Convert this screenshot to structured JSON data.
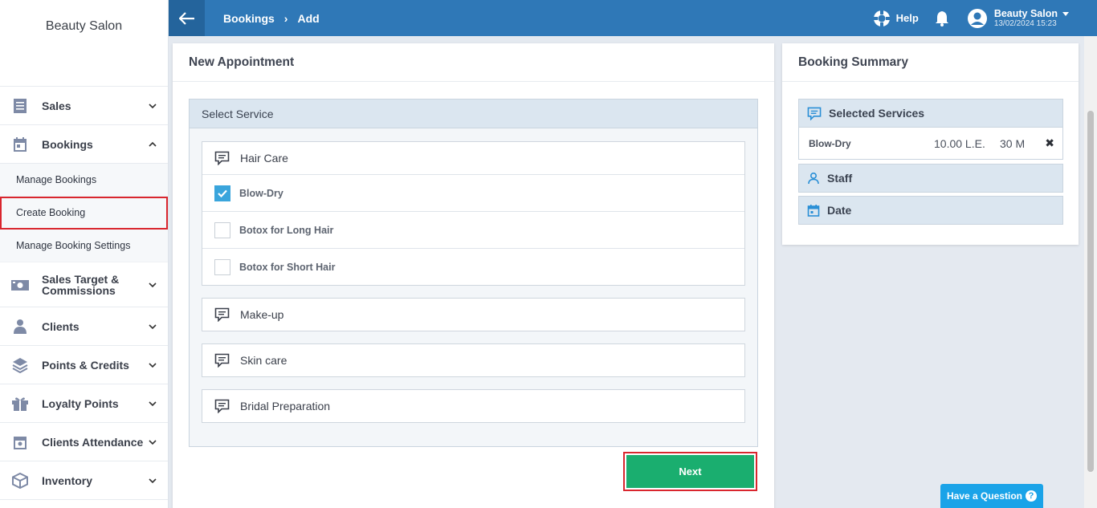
{
  "sidebar": {
    "brand": "Beauty Salon",
    "items": [
      {
        "label": "Sales",
        "icon": "receipt-icon"
      },
      {
        "label": "Bookings",
        "icon": "calendar-icon"
      },
      {
        "label": "Sales Target & Commissions",
        "icon": "money-icon"
      },
      {
        "label": "Clients",
        "icon": "client-icon"
      },
      {
        "label": "Points & Credits",
        "icon": "layers-icon"
      },
      {
        "label": "Loyalty Points",
        "icon": "gift-icon"
      },
      {
        "label": "Clients Attendance",
        "icon": "calendar-check-icon"
      },
      {
        "label": "Inventory",
        "icon": "box-icon"
      }
    ],
    "bookings_sub": [
      "Manage Bookings",
      "Create Booking",
      "Manage Booking Settings"
    ]
  },
  "topbar": {
    "crumb1": "Bookings",
    "crumb2": "Add",
    "help": "Help",
    "user_name": "Beauty Salon",
    "user_datetime": "13/02/2024 15:23"
  },
  "main": {
    "title": "New Appointment",
    "panel_title": "Select Service",
    "groups": [
      "Hair Care",
      "Make-up",
      "Skin care",
      "Bridal Preparation"
    ],
    "hair_services": [
      {
        "label": "Blow-Dry",
        "checked": true
      },
      {
        "label": "Botox for Long Hair",
        "checked": false
      },
      {
        "label": "Botox for Short Hair",
        "checked": false
      }
    ],
    "next_label": "Next"
  },
  "summary": {
    "title": "Booking Summary",
    "selected_services": "Selected Services",
    "service_name": "Blow-Dry",
    "service_price": "10.00 L.E.",
    "service_duration": "30 M",
    "remove": "✖",
    "staff": "Staff",
    "date": "Date"
  },
  "help_widget": {
    "label": "Have a Question",
    "icon": "?"
  },
  "colors": {
    "topbar": "#2f78b7",
    "next": "#1aae6f",
    "highlight": "#d9262e",
    "check": "#3aa5dc"
  }
}
